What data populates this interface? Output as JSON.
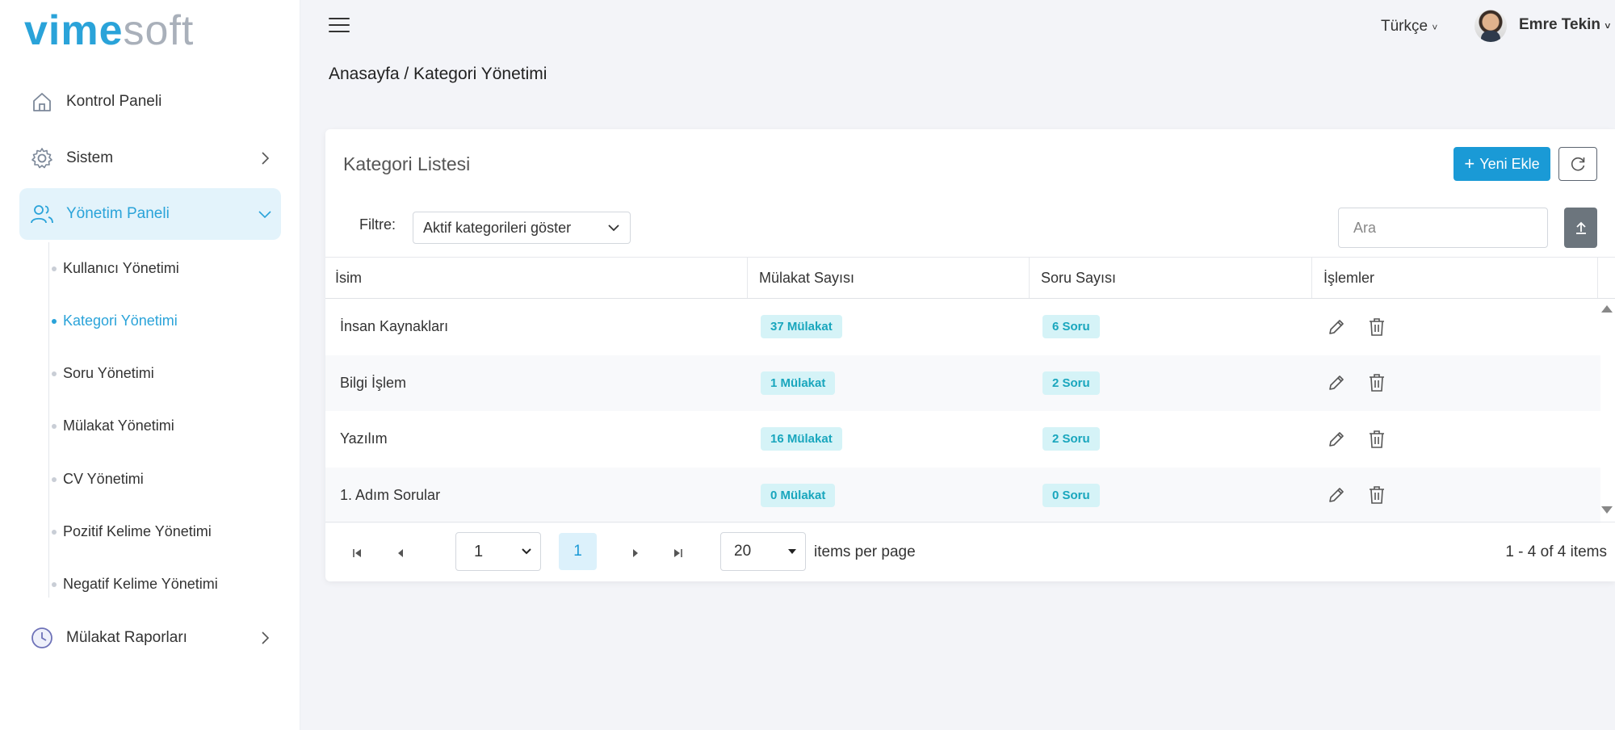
{
  "brand": {
    "part1": "vime",
    "part2": "soft"
  },
  "sidebar": {
    "items": [
      {
        "label": "Kontrol Paneli",
        "icon": "home-icon"
      },
      {
        "label": "Sistem",
        "icon": "gear-icon"
      },
      {
        "label": "Yönetim Paneli",
        "icon": "users-icon"
      },
      {
        "label": "Mülakat Raporları",
        "icon": "clock-icon"
      }
    ],
    "sub_items": [
      {
        "label": "Kullanıcı Yönetimi"
      },
      {
        "label": "Kategori Yönetimi"
      },
      {
        "label": "Soru Yönetimi"
      },
      {
        "label": "Mülakat Yönetimi"
      },
      {
        "label": "CV Yönetimi"
      },
      {
        "label": "Pozitif Kelime Yönetimi"
      },
      {
        "label": "Negatif Kelime Yönetimi"
      }
    ]
  },
  "header": {
    "language": "Türkçe",
    "user_name": "Emre Tekin"
  },
  "breadcrumb": "Anasayfa / Kategori Yönetimi",
  "card": {
    "title": "Kategori Listesi",
    "new_button": "Yeni Ekle",
    "filter_label": "Filtre:",
    "filter_value": "Aktif kategorileri göster",
    "search_placeholder": "Ara"
  },
  "table": {
    "columns": [
      "İsim",
      "Mülakat Sayısı",
      "Soru Sayısı",
      "İşlemler"
    ],
    "rows": [
      {
        "name": "İnsan Kaynakları",
        "interviews": "37 Mülakat",
        "questions": "6 Soru"
      },
      {
        "name": "Bilgi İşlem",
        "interviews": "1 Mülakat",
        "questions": "2 Soru"
      },
      {
        "name": "Yazılım",
        "interviews": "16 Mülakat",
        "questions": "2 Soru"
      },
      {
        "name": "1. Adım Sorular",
        "interviews": "0 Mülakat",
        "questions": "0 Soru"
      }
    ]
  },
  "pager": {
    "page_select": "1",
    "current_page": "1",
    "page_size": "20",
    "items_per_page": "items per page",
    "info": "1 - 4 of 4 items"
  },
  "colors": {
    "accent": "#1a9ad6",
    "badge_bg": "#d5f3f7",
    "badge_text": "#19a6bd"
  }
}
